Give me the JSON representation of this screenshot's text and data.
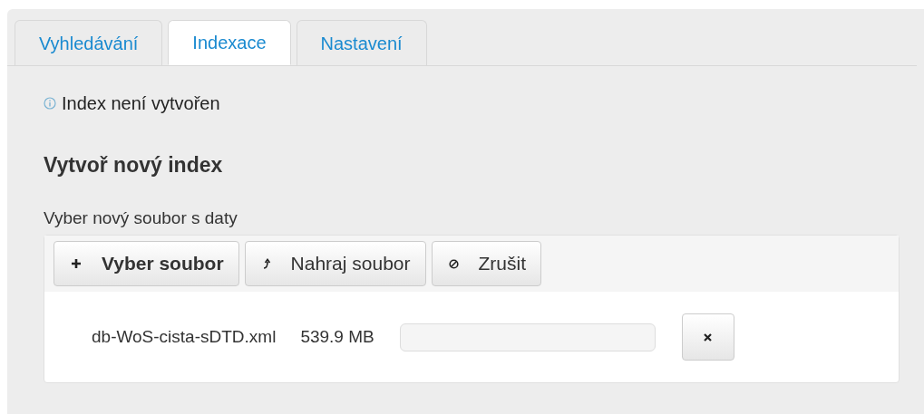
{
  "tabs": [
    {
      "label": "Vyhledávání",
      "selected": false
    },
    {
      "label": "Indexace",
      "selected": true
    },
    {
      "label": "Nastavení",
      "selected": false
    }
  ],
  "status": "Index není vytvořen",
  "heading": "Vytvoř nový index",
  "file_label": "Vyber nový soubor s daty",
  "buttons": [
    {
      "kind": "add",
      "label": "Vyber soubor",
      "bold": true
    },
    {
      "kind": "upload",
      "label": "Nahraj soubor",
      "bold": false
    },
    {
      "kind": "cancel",
      "label": "Zrušit",
      "bold": false
    }
  ],
  "files": [
    {
      "name": "db-WoS-cista-sDTD.xml",
      "size": "539.9 MB",
      "level": 0
    }
  ]
}
